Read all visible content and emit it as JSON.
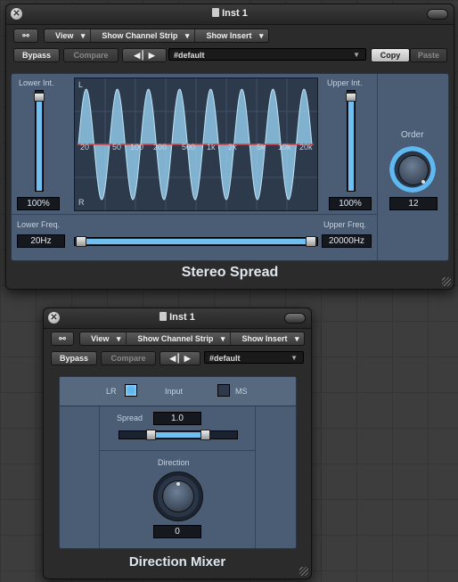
{
  "stereo_spread": {
    "window_title": "Inst 1",
    "toolbar": {
      "view": "View",
      "channel_strip": "Show Channel Strip",
      "insert": "Show Insert"
    },
    "bypass": "Bypass",
    "compare": "Compare",
    "preset": "#default",
    "copy": "Copy",
    "paste": "Paste",
    "lower_int": {
      "label": "Lower Int.",
      "value": "100%"
    },
    "upper_int": {
      "label": "Upper Int.",
      "value": "100%"
    },
    "graph": {
      "left_label": "L",
      "right_label": "R",
      "freq_ticks": [
        "20",
        "50",
        "100",
        "200",
        "500",
        "1k",
        "2k",
        "5k",
        "10k",
        "20k"
      ]
    },
    "order": {
      "label": "Order",
      "value": "12"
    },
    "lower_freq": {
      "label": "Lower Freq.",
      "value": "20Hz"
    },
    "upper_freq": {
      "label": "Upper Freq.",
      "value": "20000Hz"
    },
    "plugin_name": "Stereo Spread"
  },
  "direction_mixer": {
    "window_title": "Inst 1",
    "toolbar": {
      "view": "View",
      "channel_strip": "Show Channel Strip",
      "insert": "Show Insert"
    },
    "bypass": "Bypass",
    "compare": "Compare",
    "preset": "#default",
    "input": {
      "lr": "LR",
      "label": "Input",
      "ms": "MS",
      "lr_selected": true
    },
    "spread": {
      "label": "Spread",
      "value": "1.0"
    },
    "direction": {
      "label": "Direction",
      "value": "0"
    },
    "plugin_name": "Direction Mixer"
  },
  "colors": {
    "accent": "#5fb8f0",
    "panel": "#4a5d75",
    "red_line": "#e04040"
  }
}
